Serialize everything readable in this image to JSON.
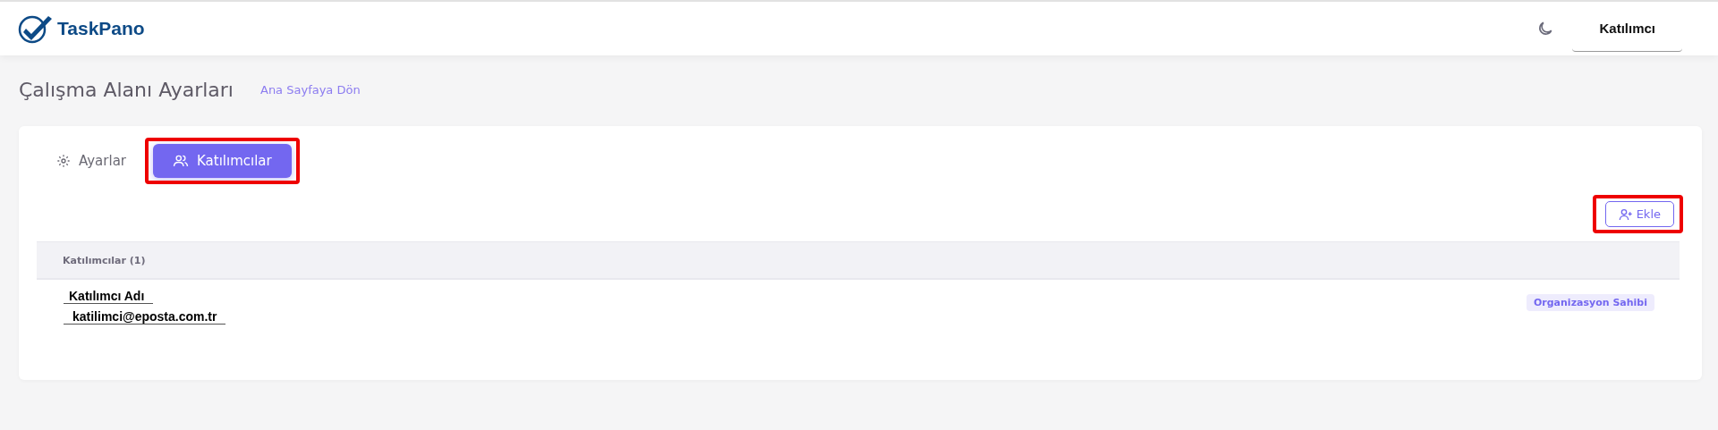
{
  "header": {
    "logo": "TaskPano",
    "user_menu": "Katılımcı"
  },
  "page": {
    "title": "Çalışma Alanı Ayarları",
    "back_link": "Ana Sayfaya Dön"
  },
  "tabs": [
    {
      "label": "Ayarlar",
      "selected": false,
      "highlighted": false
    },
    {
      "label": "Katılımcılar",
      "selected": true,
      "highlighted": true
    }
  ],
  "add_button": {
    "label": "Ekle",
    "highlighted": true
  },
  "table": {
    "heading": "Katılımcılar (1)",
    "rows": [
      {
        "name": "Katılımcı Adı",
        "email": "katilimci@eposta.com.tr",
        "role": "Organizasyon Sahibi"
      }
    ]
  }
}
